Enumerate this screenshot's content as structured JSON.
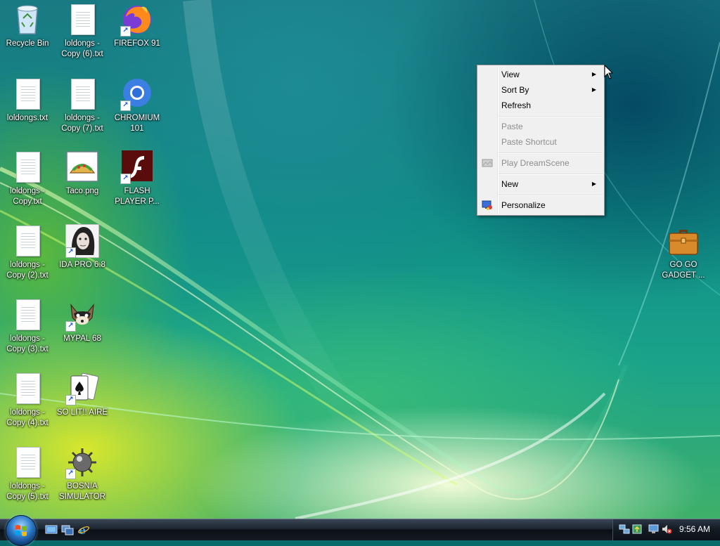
{
  "desktop": {
    "icons": [
      {
        "label": "Recycle Bin",
        "icon": "recycle-bin-icon"
      },
      {
        "label": "loldongs - Copy (6).txt",
        "icon": "text-file-icon"
      },
      {
        "label": "FIREFOX 91",
        "icon": "firefox-icon"
      },
      {
        "label": "loldongs.txt",
        "icon": "text-file-icon"
      },
      {
        "label": "loldongs - Copy (7).txt",
        "icon": "text-file-icon"
      },
      {
        "label": "CHROMIUM 101",
        "icon": "chromium-icon"
      },
      {
        "label": "loldongs - Copy.txt",
        "icon": "text-file-icon"
      },
      {
        "label": "Taco.png",
        "icon": "taco-image-icon"
      },
      {
        "label": "FLASH PLAYER P...",
        "icon": "flash-player-icon"
      },
      {
        "label": "loldongs - Copy (2).txt",
        "icon": "text-file-icon"
      },
      {
        "label": "IDA PRO 6.8",
        "icon": "ida-pro-icon"
      },
      {
        "label": "loldongs - Copy (3).txt",
        "icon": "text-file-icon"
      },
      {
        "label": "MYPAL 68",
        "icon": "mypal-icon"
      },
      {
        "label": "loldongs - Copy (4).txt",
        "icon": "text-file-icon"
      },
      {
        "label": "SO LIT!! AIRE",
        "icon": "solitaire-icon"
      },
      {
        "label": "loldongs - Copy (5).txt",
        "icon": "text-file-icon"
      },
      {
        "label": "BOSNIA SIMULATOR",
        "icon": "minesweeper-icon"
      },
      {
        "label": "GO GO GADGET ...",
        "icon": "briefcase-icon"
      }
    ]
  },
  "context_menu": {
    "view": "View",
    "sort_by": "Sort By",
    "refresh": "Refresh",
    "paste": "Paste",
    "paste_shortcut": "Paste Shortcut",
    "play_dreamscene": "Play DreamScene",
    "new": "New",
    "personalize": "Personalize"
  },
  "taskbar": {
    "clock": "9:56 AM",
    "quick_launch": [
      "show-desktop-icon",
      "switch-windows-icon",
      "internet-explorer-icon"
    ],
    "tray": [
      "network-icon",
      "sync-icon",
      "display-icon",
      "volume-muted-icon"
    ]
  },
  "colors": {
    "taskbar": "#141b22",
    "menu_bg": "#f0f0f0",
    "menu_disabled": "#8d8d8d"
  }
}
